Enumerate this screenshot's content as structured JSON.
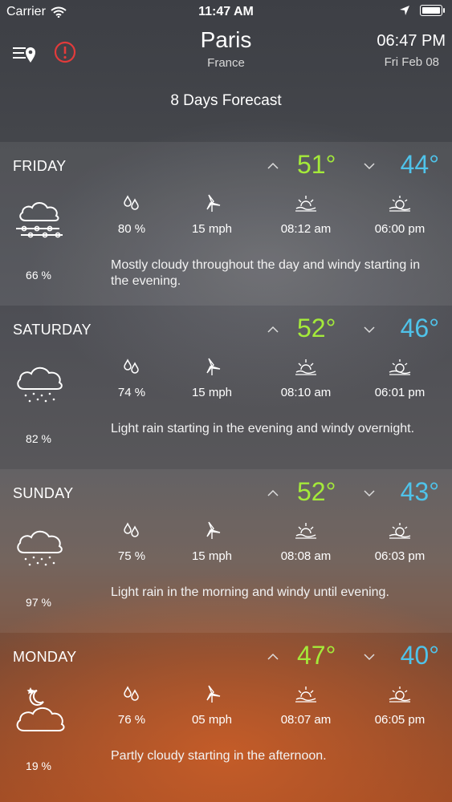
{
  "status_bar": {
    "carrier": "Carrier",
    "time": "11:47 AM"
  },
  "location": {
    "city": "Paris",
    "country": "France",
    "local_time": "06:47 PM",
    "local_date": "Fri Feb 08"
  },
  "forecast_title": "8 Days Forecast",
  "colors": {
    "high_temp": "#a4ea3a",
    "low_temp": "#4fc3ea",
    "alert": "#e23b3b"
  },
  "days": [
    {
      "name": "FRIDAY",
      "high": "51°",
      "low": "44°",
      "icon": "cloud-wind-icon",
      "humidity": "80 %",
      "wind": "15 mph",
      "sunrise": "08:12 am",
      "sunset": "06:00 pm",
      "precip": "66 %",
      "summary": "Mostly cloudy throughout the day and windy starting in the evening."
    },
    {
      "name": "SATURDAY",
      "high": "52°",
      "low": "46°",
      "icon": "cloud-rain-icon",
      "humidity": "74 %",
      "wind": "15 mph",
      "sunrise": "08:10 am",
      "sunset": "06:01 pm",
      "precip": "82 %",
      "summary": "Light rain starting in the evening and windy overnight."
    },
    {
      "name": "SUNDAY",
      "high": "52°",
      "low": "43°",
      "icon": "cloud-rain-icon",
      "humidity": "75 %",
      "wind": "15 mph",
      "sunrise": "08:08 am",
      "sunset": "06:03 pm",
      "precip": "97 %",
      "summary": "Light rain in the morning and windy until evening."
    },
    {
      "name": "MONDAY",
      "high": "47°",
      "low": "40°",
      "icon": "partly-cloudy-night-icon",
      "humidity": "76 %",
      "wind": "05 mph",
      "sunrise": "08:07 am",
      "sunset": "06:05 pm",
      "precip": "19 %",
      "summary": "Partly cloudy starting in the afternoon."
    }
  ]
}
